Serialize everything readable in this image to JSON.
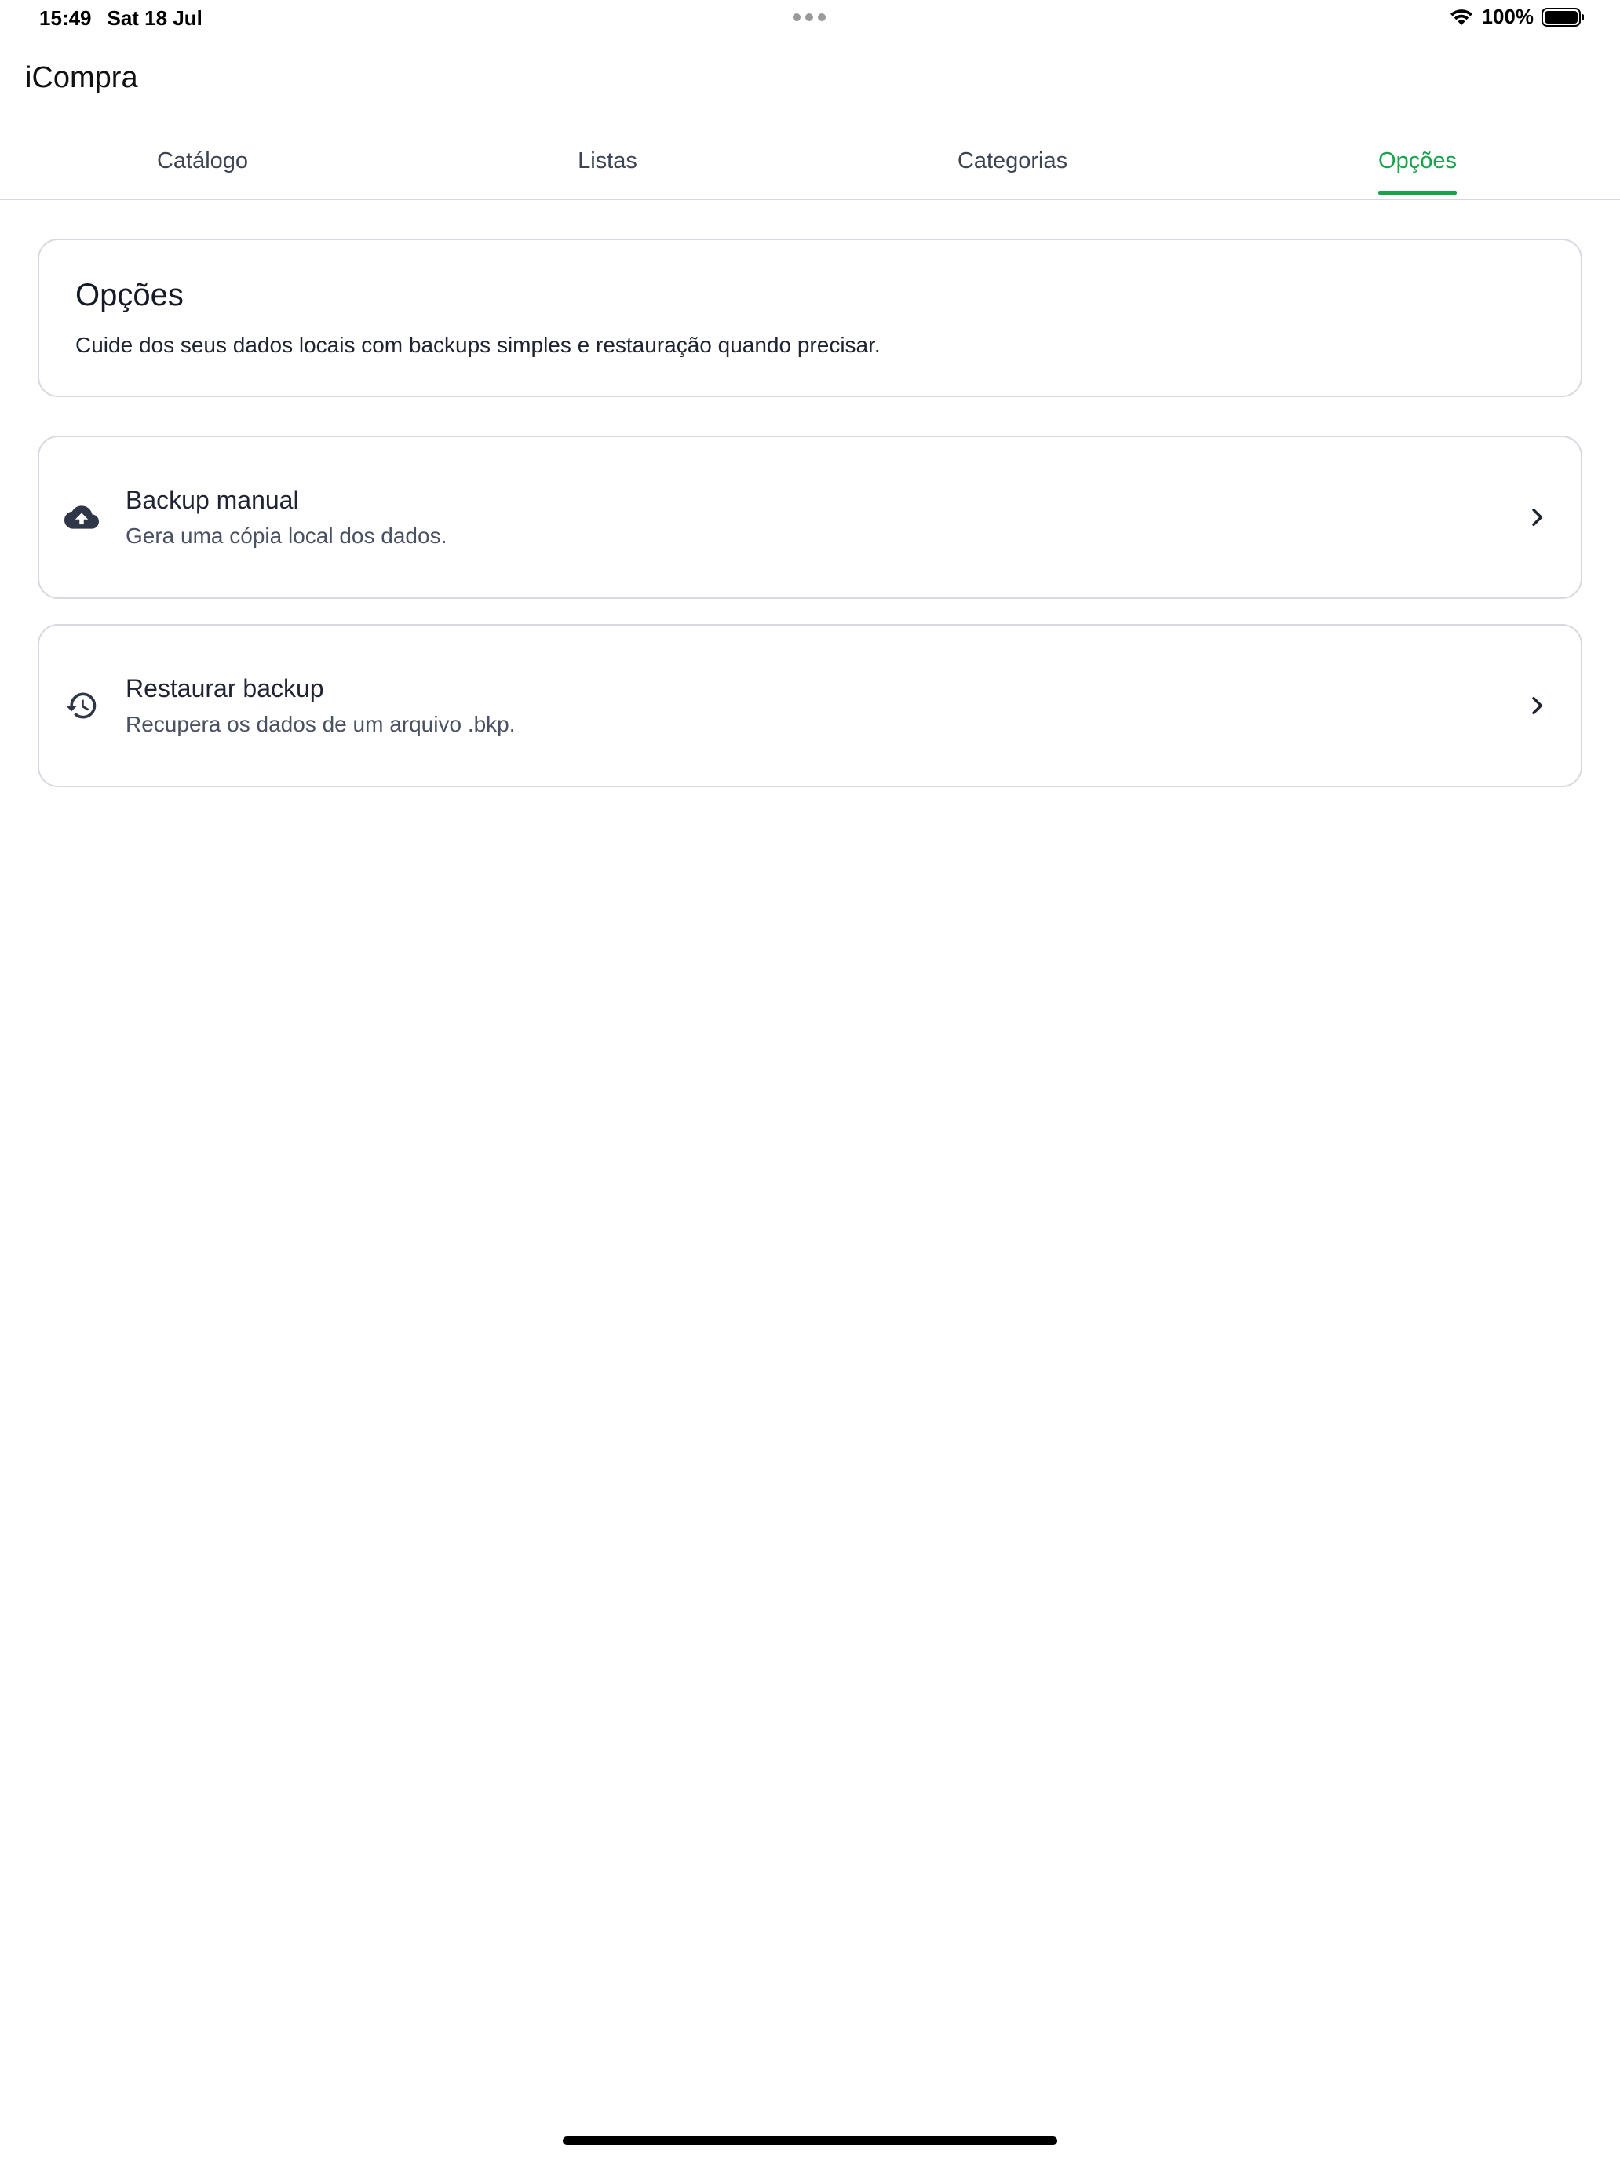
{
  "status_bar": {
    "time": "15:49",
    "date": "Sat 18 Jul",
    "battery": "100%",
    "battery_level": 1.0
  },
  "app": {
    "title": "iCompra"
  },
  "tabs": [
    {
      "label": "Catálogo",
      "active": false
    },
    {
      "label": "Listas",
      "active": false
    },
    {
      "label": "Categorias",
      "active": false
    },
    {
      "label": "Opções",
      "active": true
    }
  ],
  "intro": {
    "title": "Opções",
    "description": "Cuide dos seus dados locais com backups simples e restauração quando precisar."
  },
  "options": [
    {
      "icon": "cloud-upload-icon",
      "title": "Backup manual",
      "subtitle": "Gera uma cópia local dos dados."
    },
    {
      "icon": "history-icon",
      "title": "Restaurar backup",
      "subtitle": "Recupera os dados de um arquivo .bkp."
    }
  ],
  "colors": {
    "accent": "#16a34a",
    "text": "#1f2433",
    "muted": "#4a5163",
    "border": "#d6d9e0"
  }
}
